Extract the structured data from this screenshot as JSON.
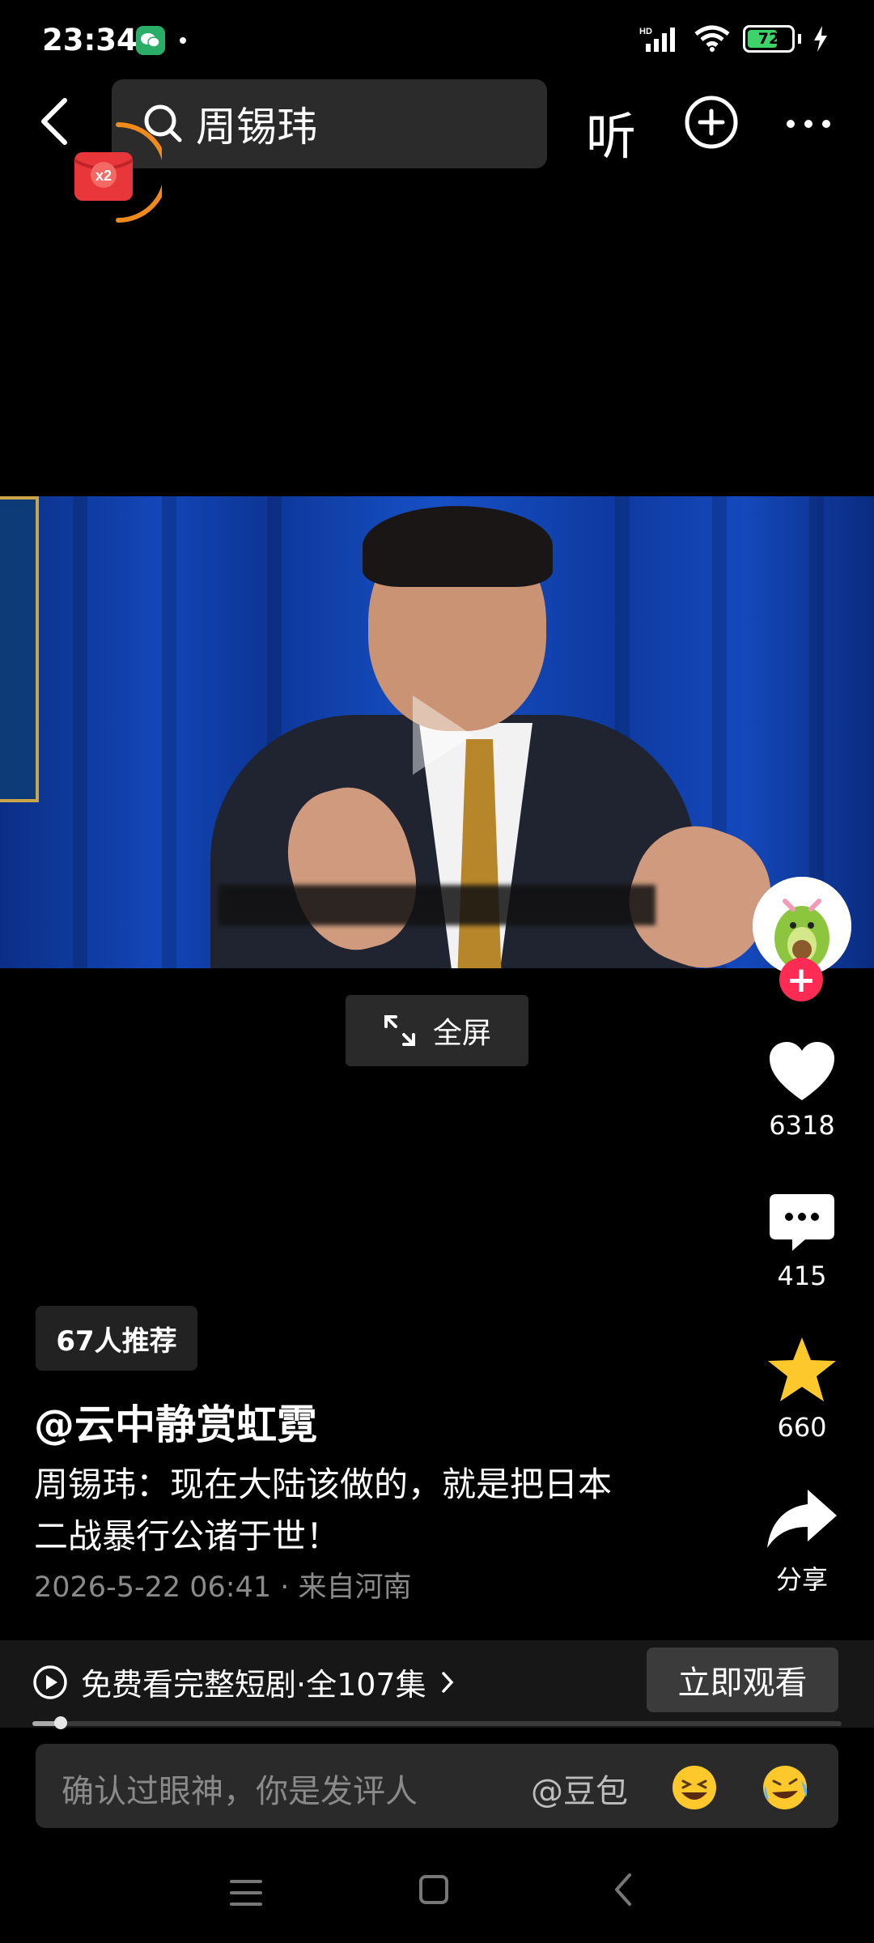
{
  "status_bar": {
    "time": "23:34",
    "battery_level": "72",
    "hd_label": "HD",
    "icons": [
      "wechat-icon",
      "signal-icon",
      "wifi-icon",
      "battery-icon",
      "charging-icon"
    ]
  },
  "header": {
    "search_text": "周锡玮",
    "listen_label": "听"
  },
  "redpacket": {
    "label": "x2"
  },
  "fullscreen_label": "全屏",
  "actions": {
    "likes": "6318",
    "comments": "415",
    "favorites": "660",
    "share_label": "分享"
  },
  "post": {
    "recommend_badge": "67人推荐",
    "author": "@云中静赏虹霓",
    "caption_line1": "周锡玮：现在大陆该做的，就是把日本",
    "caption_line2": "二战暴行公诸于世！",
    "meta": "2026-5-22 06:41 · 来自河南"
  },
  "drama": {
    "text": "免费看完整短剧·全107集",
    "watch_label": "立即观看",
    "progress": 0.035
  },
  "comment": {
    "placeholder": "确认过眼神，你是发评人",
    "mention": "@豆包"
  },
  "colors": {
    "accent_red": "#fe2c55",
    "favorite_yellow": "#fcc82c",
    "battery_green": "#3ed36a",
    "redpacket_ring": "#f08a1c"
  }
}
